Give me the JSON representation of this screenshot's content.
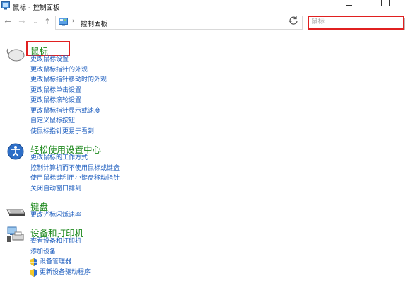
{
  "window": {
    "title": "鼠标 - 控制面板"
  },
  "address": {
    "path": "控制面板",
    "sep": "›"
  },
  "search": {
    "value": "鼠标",
    "placeholder": "鼠标"
  },
  "colors": {
    "title_green": "#1f8a1f",
    "link_blue": "#1e5ebf",
    "highlight_red": "#e02020"
  },
  "sections": [
    {
      "icon": "mouse-icon",
      "title": "鼠标",
      "links": [
        "更改鼠标设置",
        "更改鼠标指针的外观",
        "更改鼠标指针移动时的外观",
        "更改鼠标单击设置",
        "更改鼠标滚轮设置",
        "更改鼠标指针显示或速度",
        "自定义鼠标按钮",
        "使鼠标指针更易于看到"
      ]
    },
    {
      "icon": "ease-of-access-icon",
      "title": "轻松使用设置中心",
      "links": [
        "更改鼠标的工作方式",
        "控制计算机而不使用鼠标或键盘",
        "使用鼠标键利用小键盘移动指针",
        "关闭自动窗口排列"
      ]
    },
    {
      "icon": "keyboard-icon",
      "title": "键盘",
      "links": [
        "更改光标闪烁速率"
      ]
    },
    {
      "icon": "devices-printers-icon",
      "title": "设备和打印机",
      "links": [
        "查看设备和打印机",
        "添加设备",
        "设备管理器",
        "更新设备驱动程序"
      ]
    }
  ]
}
